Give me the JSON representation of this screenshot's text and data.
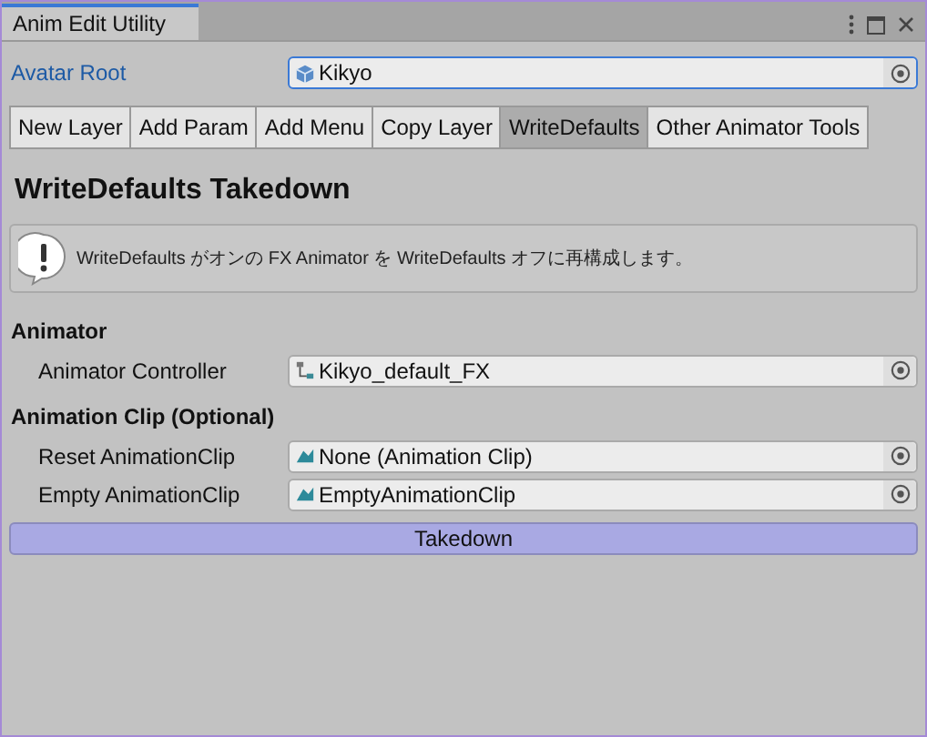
{
  "window": {
    "title": "Anim Edit Utility"
  },
  "avatar_root": {
    "label": "Avatar Root",
    "value": "Kikyo",
    "focused": true
  },
  "tabs": [
    {
      "label": "New Layer",
      "selected": false
    },
    {
      "label": "Add Param",
      "selected": false
    },
    {
      "label": "Add Menu",
      "selected": false
    },
    {
      "label": "Copy Layer",
      "selected": false
    },
    {
      "label": "WriteDefaults",
      "selected": true
    },
    {
      "label": "Other Animator Tools",
      "selected": false
    }
  ],
  "heading": "WriteDefaults Takedown",
  "info": "WriteDefaults がオンの FX Animator を WriteDefaults オフに再構成します。",
  "sections": [
    {
      "title": "Animator",
      "fields": [
        {
          "label": "Animator Controller",
          "value": "Kikyo_default_FX",
          "kind": "controller"
        }
      ]
    },
    {
      "title": "Animation Clip (Optional)",
      "fields": [
        {
          "label": "Reset AnimationClip",
          "value": "None (Animation Clip)",
          "kind": "clip"
        },
        {
          "label": "Empty AnimationClip",
          "value": "EmptyAnimationClip",
          "kind": "clip"
        }
      ]
    }
  ],
  "action": "Takedown"
}
